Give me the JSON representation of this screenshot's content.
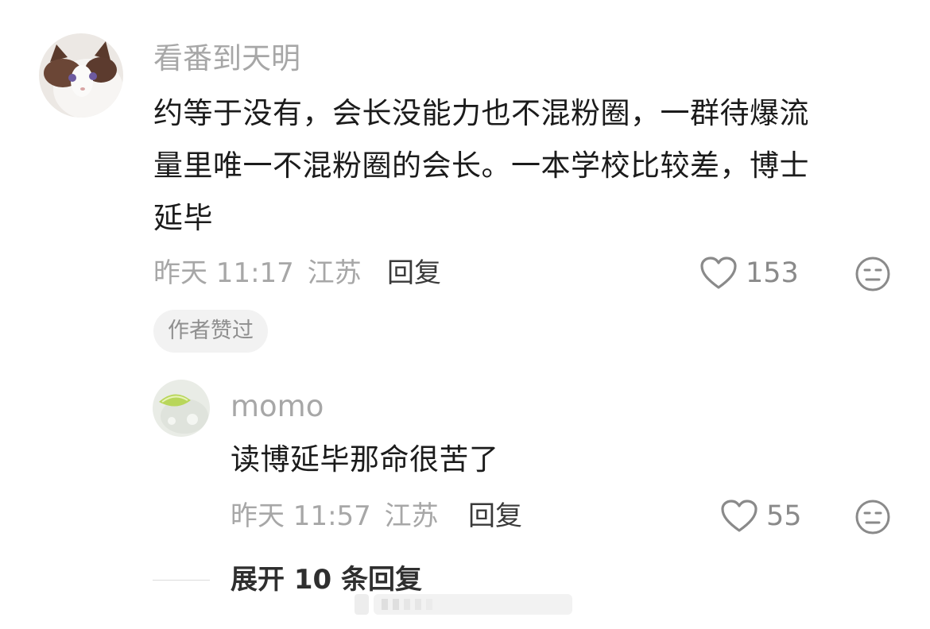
{
  "comment": {
    "username": "看番到天明",
    "text_lines": [
      "约等于没有，会长没能力也不混粉圈，一群待爆流",
      "量里唯一不混粉圈的会长。一本学校比较差，博士",
      "延毕"
    ],
    "time": "昨天 11:17",
    "location": "江苏",
    "reply_label": "回复",
    "like_count": "153",
    "author_badge": "作者赞过"
  },
  "reply": {
    "username": "momo",
    "text": "读博延毕那命很苦了",
    "time": "昨天 11:57",
    "location": "江苏",
    "reply_label": "回复",
    "like_count": "55"
  },
  "expand": {
    "label": "展开 10 条回复"
  },
  "colors": {
    "text_primary": "#1b1b1b",
    "text_secondary": "#a7a7a7",
    "badge_bg": "#f2f2f2"
  }
}
